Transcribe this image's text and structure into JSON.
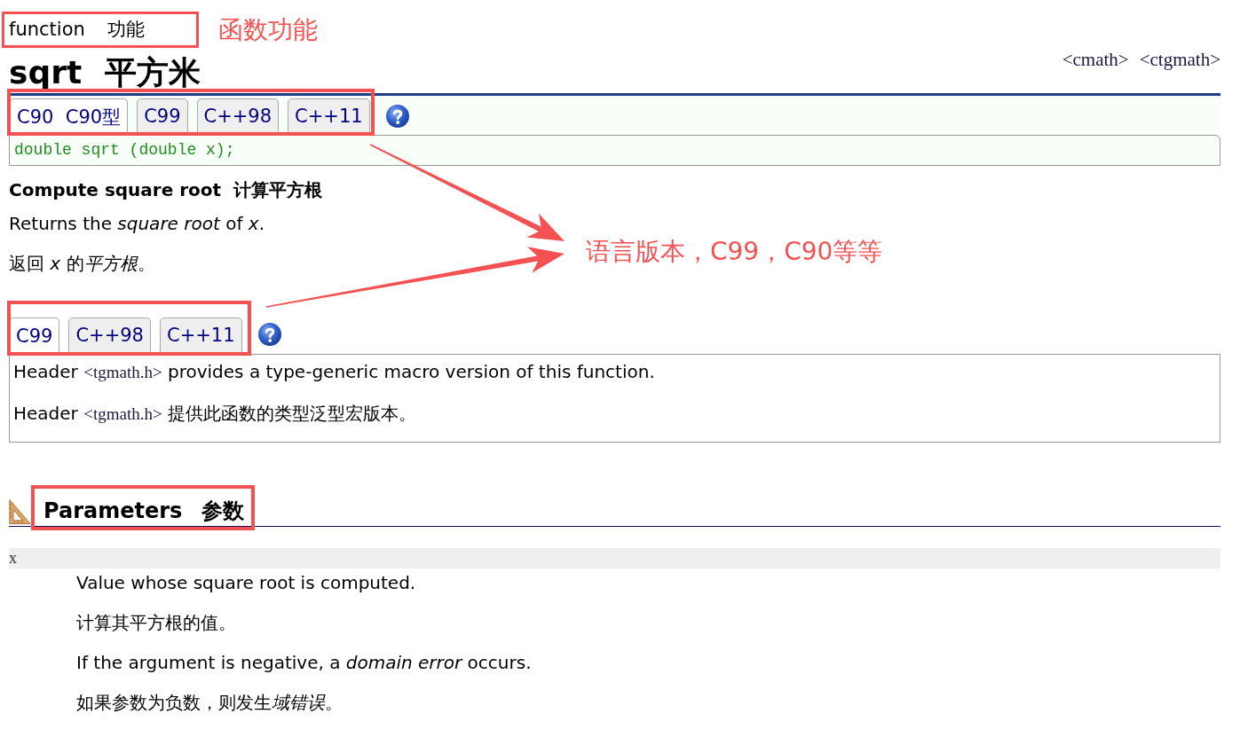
{
  "header": {
    "category": "function",
    "category_zh": "功能",
    "title": "sqrt",
    "title_zh": "平方米",
    "headers": [
      "<cmath>",
      "<ctgmath>"
    ]
  },
  "prototype_tabs": [
    {
      "label": "C90  C90型",
      "selected": true
    },
    {
      "label": "C99",
      "selected": false
    },
    {
      "label": "C++98",
      "selected": false
    },
    {
      "label": "C++11",
      "selected": false
    }
  ],
  "prototype": "double sqrt (double x);",
  "summary": {
    "heading": "Compute square root",
    "heading_zh": "计算平方根",
    "paragraphs": [
      [
        {
          "text": "Returns the ",
          "italic": false
        },
        {
          "text": "square root",
          "italic": true
        },
        {
          "text": " of ",
          "italic": false
        },
        {
          "text": "x",
          "italic": true
        },
        {
          "text": ".",
          "italic": false
        }
      ],
      [
        {
          "text": "返回 ",
          "italic": false
        },
        {
          "text": "x",
          "italic": true
        },
        {
          "text": " 的",
          "italic": false
        },
        {
          "text": "平方根",
          "italic": true
        },
        {
          "text": "。",
          "italic": false
        }
      ]
    ]
  },
  "note_tabs": [
    {
      "label": "C99",
      "selected": true
    },
    {
      "label": "C++98",
      "selected": false
    },
    {
      "label": "C++11",
      "selected": false
    }
  ],
  "note": [
    {
      "before": "Header",
      "header": "<tgmath.h>",
      "after": "provides a type-generic macro version of this function."
    },
    {
      "before": "Header",
      "header": "<tgmath.h>",
      "after": "提供此函数的类型泛型宏版本。"
    }
  ],
  "parameters": {
    "heading": "Parameters",
    "heading_zh": "参数",
    "items": [
      {
        "name": "x",
        "description": [
          [
            {
              "text": "Value whose square root is computed.",
              "italic": false
            }
          ],
          [
            {
              "text": "计算其平方根的值。",
              "italic": false
            }
          ],
          [
            {
              "text": "If the argument is negative, a ",
              "italic": false
            },
            {
              "text": "domain error",
              "italic": true
            },
            {
              "text": " occurs.",
              "italic": false
            }
          ],
          [
            {
              "text": "如果参数为负数，则发生",
              "italic": false
            },
            {
              "text": "域错误",
              "italic": true
            },
            {
              "text": "。",
              "italic": false
            }
          ]
        ]
      }
    ]
  },
  "annotations": {
    "function_note": "函数功能",
    "versions_note": "语言版本，C99，C90等等"
  }
}
